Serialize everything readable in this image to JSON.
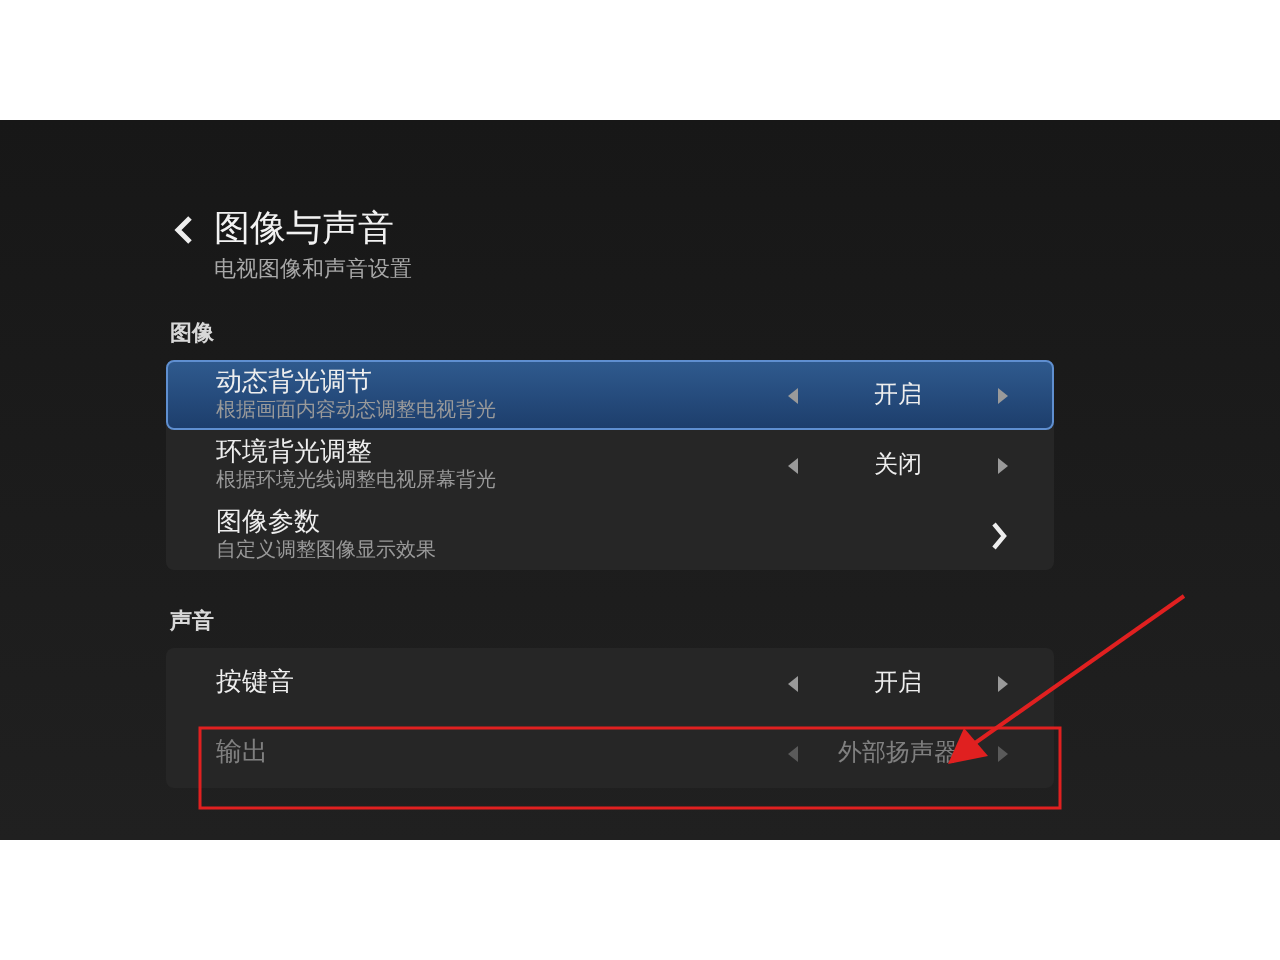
{
  "header": {
    "title": "图像与声音",
    "subtitle": "电视图像和声音设置"
  },
  "sections": [
    {
      "title": "图像",
      "rows": [
        {
          "kind": "selector",
          "title": "动态背光调节",
          "description": "根据画面内容动态调整电视背光",
          "value": "开启",
          "selected": true,
          "disabled": false
        },
        {
          "kind": "selector",
          "title": "环境背光调整",
          "description": "根据环境光线调整电视屏幕背光",
          "value": "关闭",
          "selected": false,
          "disabled": false
        },
        {
          "kind": "link",
          "title": "图像参数",
          "description": "自定义调整图像显示效果",
          "selected": false,
          "disabled": false
        }
      ]
    },
    {
      "title": "声音",
      "rows": [
        {
          "kind": "selector",
          "title": "按键音",
          "value": "开启",
          "selected": false,
          "disabled": false
        },
        {
          "kind": "selector",
          "title": "输出",
          "value": "外部扬声器",
          "selected": false,
          "disabled": true
        }
      ]
    }
  ]
}
